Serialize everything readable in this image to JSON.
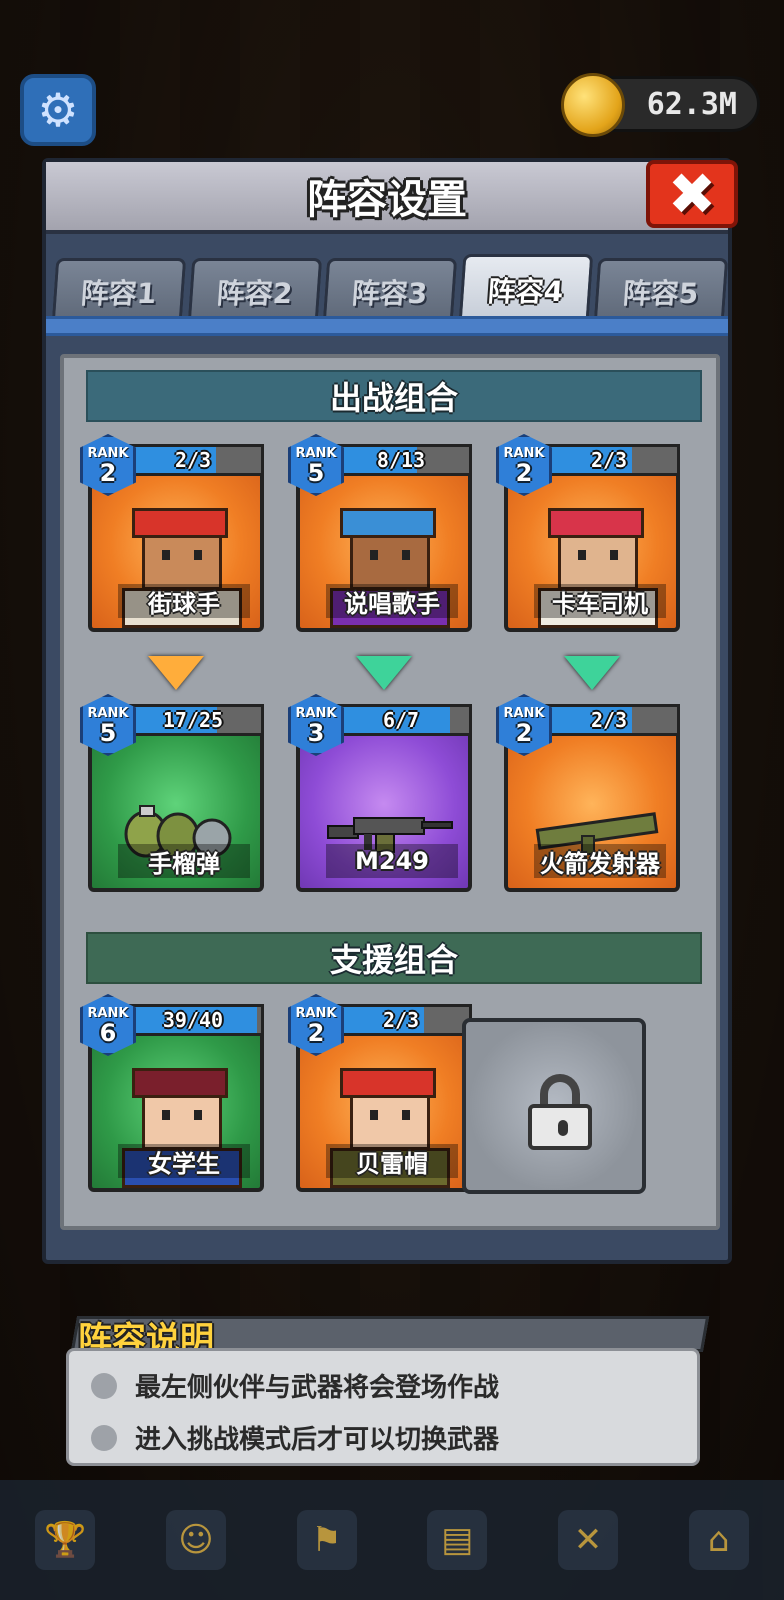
{
  "hud": {
    "coins": "62.3M"
  },
  "panel": {
    "title": "阵容设置",
    "close_label": "✖",
    "tabs": [
      "阵容1",
      "阵容2",
      "阵容3",
      "阵容4",
      "阵容5"
    ],
    "active_tab": 3
  },
  "battle_section": {
    "title": "出战组合",
    "heroes": [
      {
        "rank_label": "RANK",
        "rank": "2",
        "progress": "2/3",
        "fill": 0.67,
        "name": "街球手",
        "theme": "orange"
      },
      {
        "rank_label": "RANK",
        "rank": "5",
        "progress": "8/13",
        "fill": 0.62,
        "name": "说唱歌手",
        "theme": "orange"
      },
      {
        "rank_label": "RANK",
        "rank": "2",
        "progress": "2/3",
        "fill": 0.67,
        "name": "卡车司机",
        "theme": "orange"
      }
    ],
    "weapons": [
      {
        "rank_label": "RANK",
        "rank": "5",
        "progress": "17/25",
        "fill": 0.68,
        "name": "手榴弹",
        "theme": "green"
      },
      {
        "rank_label": "RANK",
        "rank": "3",
        "progress": "6/7",
        "fill": 0.86,
        "name": "M249",
        "theme": "purple"
      },
      {
        "rank_label": "RANK",
        "rank": "2",
        "progress": "2/3",
        "fill": 0.67,
        "name": "火箭发射器",
        "theme": "orange"
      }
    ]
  },
  "support_section": {
    "title": "支援组合",
    "members": [
      {
        "rank_label": "RANK",
        "rank": "6",
        "progress": "39/40",
        "fill": 0.97,
        "name": "女学生",
        "theme": "green"
      },
      {
        "rank_label": "RANK",
        "rank": "2",
        "progress": "2/3",
        "fill": 0.67,
        "name": "贝雷帽",
        "theme": "orange"
      }
    ]
  },
  "description": {
    "title": "阵容说明",
    "lines": [
      "最左侧伙伴与武器将会登场作战",
      "进入挑战模式后才可以切换武器"
    ]
  },
  "colors": {
    "accent_blue": "#2f8fe0",
    "close_red": "#e3341c",
    "section_battle": "#3b6a7a",
    "section_support": "#3e6a55"
  }
}
